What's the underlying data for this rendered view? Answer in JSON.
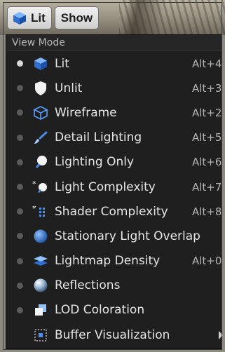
{
  "toolbar": {
    "lit_label": "Lit",
    "show_label": "Show"
  },
  "menu": {
    "section_title": "View Mode",
    "items": [
      {
        "label": "Lit",
        "shortcut": "Alt+4",
        "icon": "cube-lit-icon",
        "selected": true
      },
      {
        "label": "Unlit",
        "shortcut": "Alt+3",
        "icon": "shield-icon"
      },
      {
        "label": "Wireframe",
        "shortcut": "Alt+2",
        "icon": "wireframe-cube-icon"
      },
      {
        "label": "Detail Lighting",
        "shortcut": "Alt+5",
        "icon": "brush-icon"
      },
      {
        "label": "Lighting Only",
        "shortcut": "Alt+6",
        "icon": "bulb-icon"
      },
      {
        "label": "Light Complexity",
        "shortcut": "Alt+7",
        "icon": "light-complexity-icon"
      },
      {
        "label": "Shader Complexity",
        "shortcut": "Alt+8",
        "icon": "shader-complexity-icon"
      },
      {
        "label": "Stationary Light Overlap",
        "shortcut": "",
        "icon": "sphere-icon"
      },
      {
        "label": "Lightmap Density",
        "shortcut": "Alt+0",
        "icon": "layers-icon"
      },
      {
        "label": "Reflections",
        "shortcut": "",
        "icon": "reflection-sphere-icon"
      },
      {
        "label": "LOD Coloration",
        "shortcut": "",
        "icon": "lod-icon"
      },
      {
        "label": "Buffer Visualization",
        "shortcut": "",
        "icon": "buffer-grid-icon",
        "submenu": true
      }
    ]
  },
  "colors": {
    "menu_bg": "#1f1f1f",
    "text": "#e6e6e6",
    "shortcut": "#b3b3b3",
    "accent_blue": "#3a7bd5"
  }
}
